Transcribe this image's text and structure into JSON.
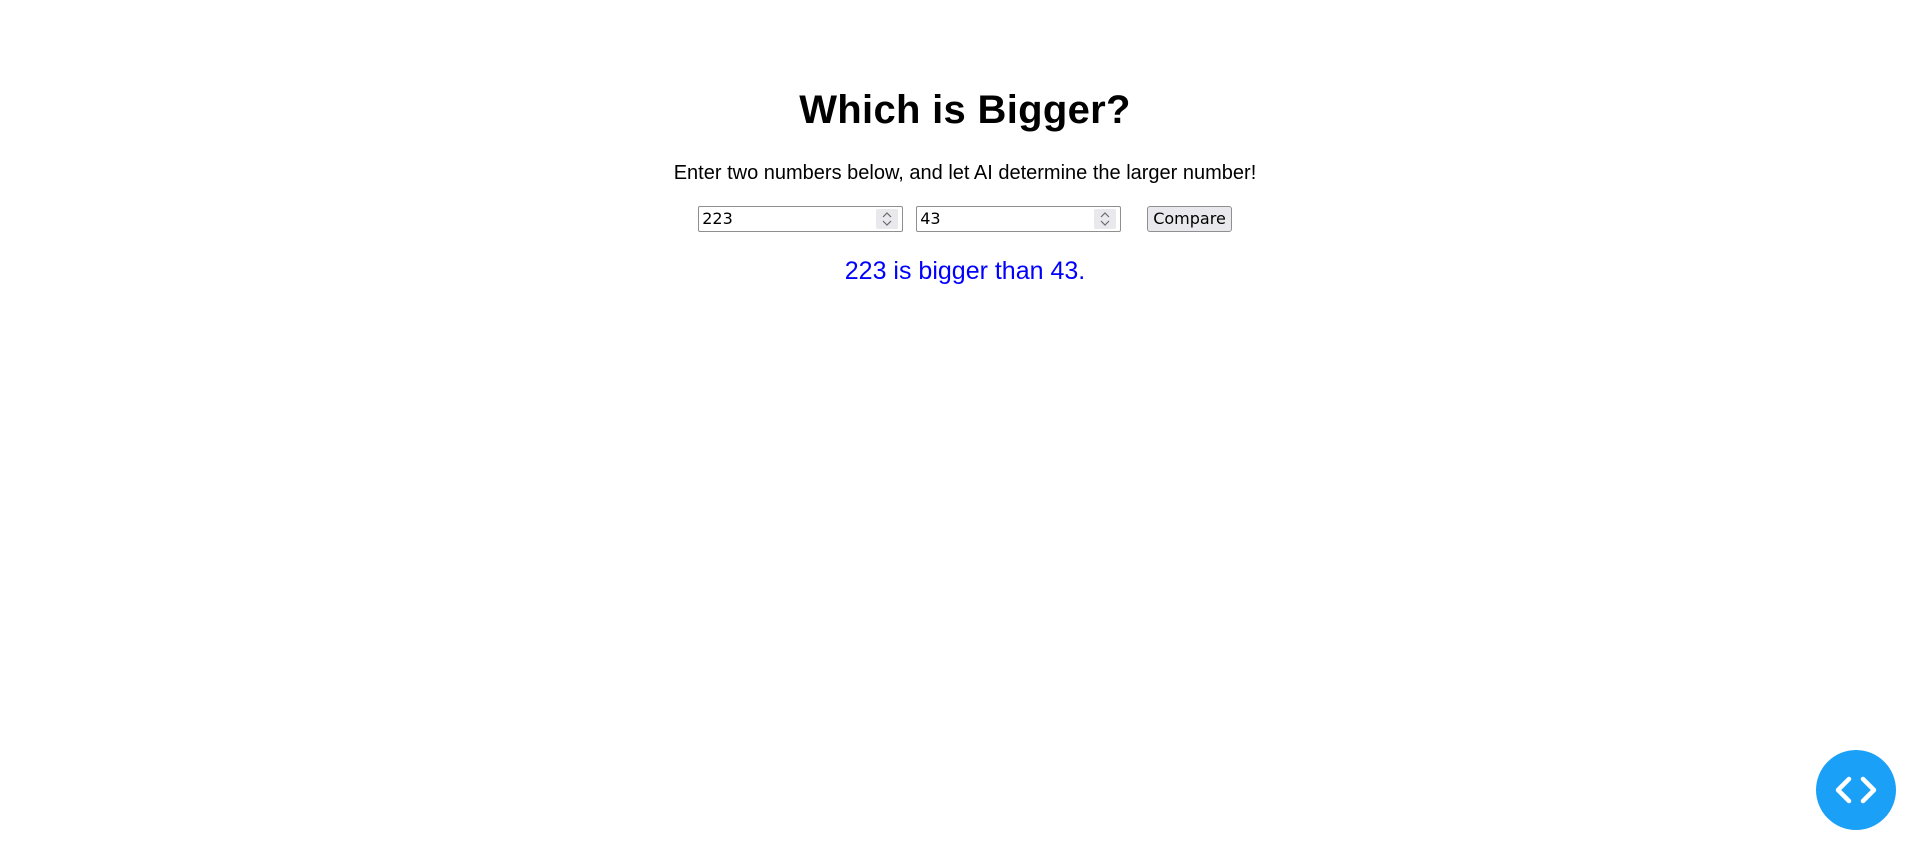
{
  "header": {
    "title": "Which is Bigger?",
    "subtitle": "Enter two numbers below, and let AI determine the larger number!"
  },
  "form": {
    "first_number": "223",
    "second_number": "43",
    "compare_label": "Compare"
  },
  "result": {
    "text": "223 is bigger than 43."
  },
  "colors": {
    "result_text": "#0000ff",
    "fab_background": "#1aa1f7"
  },
  "icons": {
    "fab": "code-icon",
    "spinner_up": "chevron-up-icon",
    "spinner_down": "chevron-down-icon"
  }
}
